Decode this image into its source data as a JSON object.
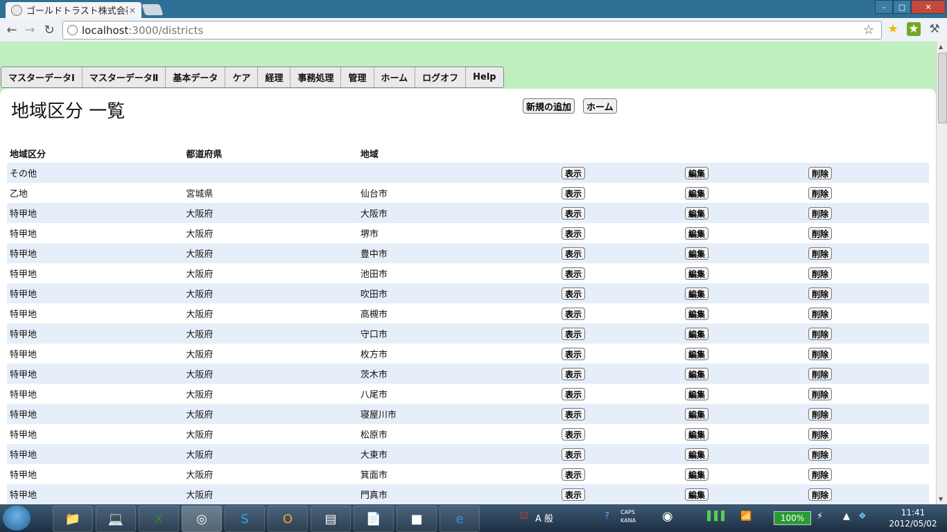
{
  "browser": {
    "tab_title": "ゴールドトラスト株式会社",
    "tab_close": "×",
    "url_host": "localhost",
    "url_path": ":3000/districts"
  },
  "menu": {
    "items": [
      {
        "label": "マスターデータⅠ"
      },
      {
        "label": "マスターデータⅡ"
      },
      {
        "label": "基本データ"
      },
      {
        "label": "ケア"
      },
      {
        "label": "経理"
      },
      {
        "label": "事務処理"
      },
      {
        "label": "管理"
      },
      {
        "label": "ホーム"
      },
      {
        "label": "ログオフ"
      },
      {
        "label": "Help"
      }
    ]
  },
  "page": {
    "title": "地域区分 一覧",
    "new_button": "新規の追加",
    "home_button": "ホーム"
  },
  "table": {
    "headers": [
      "地域区分",
      "都道府県",
      "地域"
    ],
    "action_labels": {
      "show": "表示",
      "edit": "編集",
      "delete": "削除"
    },
    "rows": [
      {
        "district": "その他",
        "prefecture": "",
        "area": ""
      },
      {
        "district": "乙地",
        "prefecture": "宮城県",
        "area": "仙台市"
      },
      {
        "district": "特甲地",
        "prefecture": "大阪府",
        "area": "大阪市"
      },
      {
        "district": "特甲地",
        "prefecture": "大阪府",
        "area": "堺市"
      },
      {
        "district": "特甲地",
        "prefecture": "大阪府",
        "area": "豊中市"
      },
      {
        "district": "特甲地",
        "prefecture": "大阪府",
        "area": "池田市"
      },
      {
        "district": "特甲地",
        "prefecture": "大阪府",
        "area": "吹田市"
      },
      {
        "district": "特甲地",
        "prefecture": "大阪府",
        "area": "高槻市"
      },
      {
        "district": "特甲地",
        "prefecture": "大阪府",
        "area": "守口市"
      },
      {
        "district": "特甲地",
        "prefecture": "大阪府",
        "area": "枚方市"
      },
      {
        "district": "特甲地",
        "prefecture": "大阪府",
        "area": "茨木市"
      },
      {
        "district": "特甲地",
        "prefecture": "大阪府",
        "area": "八尾市"
      },
      {
        "district": "特甲地",
        "prefecture": "大阪府",
        "area": "寝屋川市"
      },
      {
        "district": "特甲地",
        "prefecture": "大阪府",
        "area": "松原市"
      },
      {
        "district": "特甲地",
        "prefecture": "大阪府",
        "area": "大東市"
      },
      {
        "district": "特甲地",
        "prefecture": "大阪府",
        "area": "箕面市"
      },
      {
        "district": "特甲地",
        "prefecture": "大阪府",
        "area": "門真市"
      }
    ]
  },
  "taskbar": {
    "battery": "100%",
    "time": "11:41",
    "date": "2012/05/02",
    "ime": "A 般",
    "caps": "CAPS",
    "kana": "KANA"
  },
  "colors": {
    "page_bg": "#bfefbf",
    "row_alt": "#e6eefa",
    "tabstrip": "#2f6f96"
  }
}
